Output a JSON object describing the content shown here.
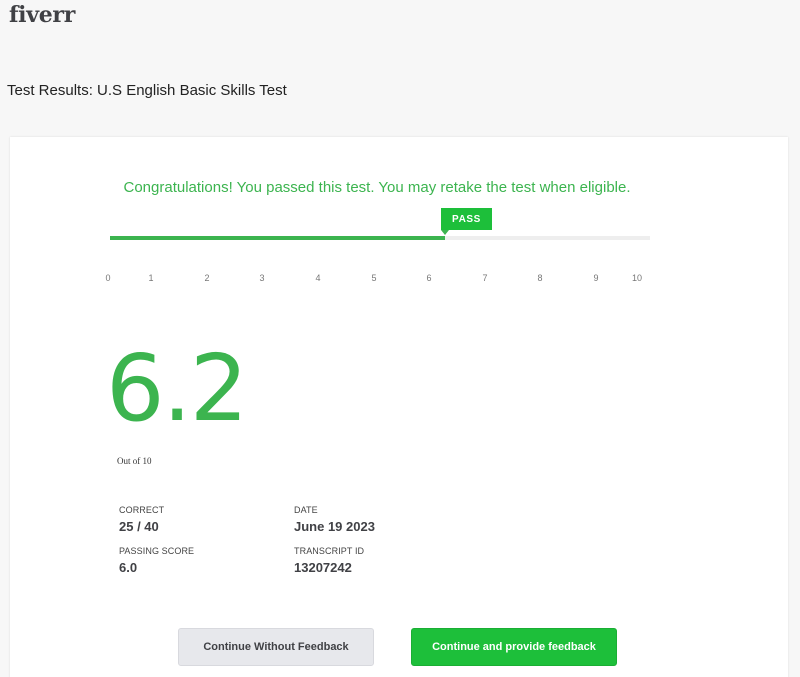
{
  "brand": {
    "logo_text": "fiverr"
  },
  "header": {
    "title": "Test Results:  U.S English Basic Skills Test"
  },
  "result": {
    "message": "Congratulations! You passed this test. You may retake the test when eligible.",
    "badge": "PASS",
    "score": 6.2,
    "score_text": "6.2",
    "score_max": 10,
    "out_of_text": "Out of 10",
    "scale_ticks": [
      "0",
      "1",
      "2",
      "3",
      "4",
      "5",
      "6",
      "7",
      "8",
      "9",
      "10"
    ]
  },
  "stats": {
    "correct_label": "CORRECT",
    "correct_value": "25 / 40",
    "date_label": "DATE",
    "date_value": "June 19 2023",
    "passing_label": "PASSING SCORE",
    "passing_value": "6.0",
    "transcript_label": "TRANSCRIPT ID",
    "transcript_value": "13207242"
  },
  "actions": {
    "without_feedback": "Continue Without Feedback",
    "with_feedback": "Continue and provide feedback"
  },
  "colors": {
    "accent": "#1dbf3a",
    "score_green": "#3cb44f",
    "page_bg": "#f7f7f7"
  }
}
